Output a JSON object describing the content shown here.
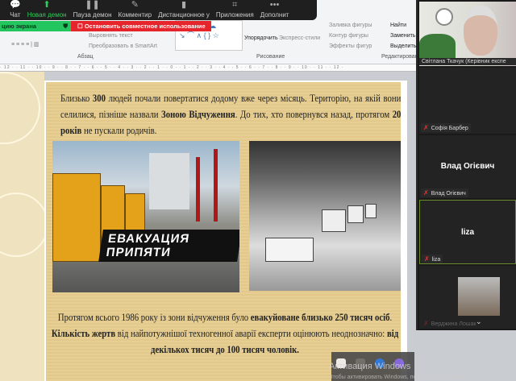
{
  "zoom_toolbar": {
    "items": [
      {
        "label": "Чат",
        "icon": "chat-icon"
      },
      {
        "label": "Новая демон",
        "icon": "share-screen-icon",
        "active": true
      },
      {
        "label": "Пауза демон",
        "icon": "pause-icon"
      },
      {
        "label": "Комментир",
        "icon": "pencil-icon"
      },
      {
        "label": "Дистанционное у",
        "icon": "mouse-icon"
      },
      {
        "label": "Приложения",
        "icon": "apps-icon"
      },
      {
        "label": "Дополнит",
        "icon": "more-icon"
      }
    ]
  },
  "share_bar": {
    "status": "цию экрана",
    "stop_label": "Остановить совместное использование",
    "green": "#22c55e",
    "red": "#e5242b"
  },
  "ribbon": {
    "paragraph_group": "Абзац",
    "align_text": "Выровнять текст",
    "convert_smartart": "Преобразовать в SmartArt",
    "drawing_group": "Рисование",
    "arrange": "Упорядочить",
    "quick_styles": "Экспресс-стили",
    "shape_fill": "Заливка фигуры",
    "shape_outline": "Контур фигуры",
    "shape_effects": "Эффекты фигур",
    "find": "Найти",
    "replace": "Заменить",
    "select": "Выделить",
    "editing_group": "Редактирование"
  },
  "ruler": "· 12 · · 11 · · 10 · · 9 · · 8 · · 7 · · 6 · · 5 · · 4 · · 3 · · 2 · · 1 · · 0 · · 1 · · 2 · · 3 · · 4 · · 5 · · 6 · · 7 · · 8 · · 9 · · 10 · · 11 · · 12 ·",
  "slide": {
    "p1": [
      {
        "t": "Близько "
      },
      {
        "t": "300",
        "b": true
      },
      {
        "t": " людей почали повертатися додому вже через місяць. Територію, на якій вони селилися, пізніше назвали "
      },
      {
        "t": "Зоною Відчуження",
        "b": true
      },
      {
        "t": ". До тих, хто повернувся назад, протягом "
      },
      {
        "t": "20 років",
        "b": true
      },
      {
        "t": " не пускали родичів."
      }
    ],
    "image1_caption": "ЕВАКУАЦИЯ ПРИПЯТИ",
    "p2": [
      {
        "t": "Протягом всього 1986 року із зони відчуження було "
      },
      {
        "t": "евакуйоване близько 250 тисяч осіб",
        "b": true
      },
      {
        "t": ". "
      },
      {
        "t": "Кількість жертв",
        "b": true
      },
      {
        "t": " від найпотужнішої техногенної аварії експерти оцінюють неоднозначно: "
      },
      {
        "t": "від декількох тисяч до 100 тисяч чоловік.",
        "b": true
      }
    ]
  },
  "participants": [
    {
      "name": "Світлана Ткачук (Керівник експе",
      "video": true
    },
    {
      "name": "Софія Барбер",
      "muted": true
    },
    {
      "name": "Влад Огієвич",
      "display": "Влад Огієвич",
      "muted": true
    },
    {
      "name": "liza",
      "display": "liza",
      "muted": true,
      "active": true
    },
    {
      "name": "Верджина Лошак",
      "muted": true,
      "avatar": true
    }
  ],
  "windows_activation": {
    "title": "Активация Windows",
    "subtitle": "Чтобы активировать Windows, перейдите в раздел"
  }
}
